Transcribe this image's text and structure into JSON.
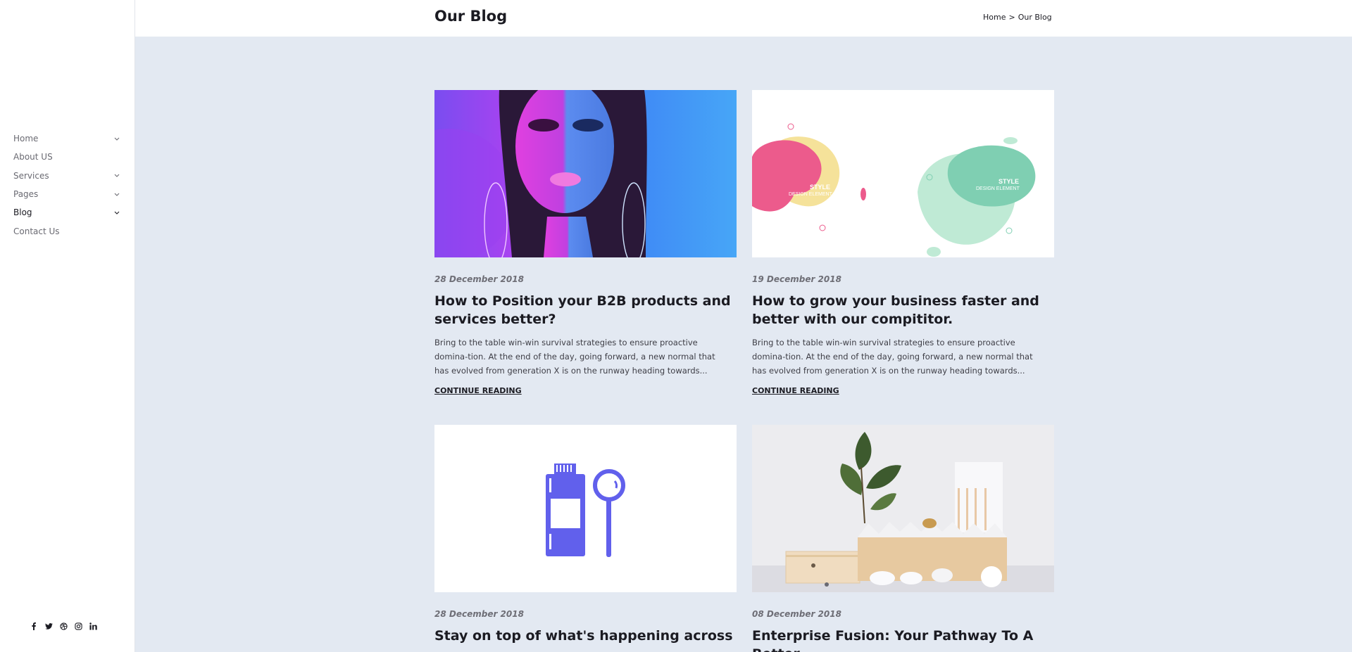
{
  "sidebar": {
    "nav": [
      {
        "label": "Home",
        "has_children": true
      },
      {
        "label": "About US",
        "has_children": false
      },
      {
        "label": "Services",
        "has_children": true
      },
      {
        "label": "Pages",
        "has_children": true
      },
      {
        "label": "Blog",
        "has_children": true,
        "active": true
      },
      {
        "label": "Contact Us",
        "has_children": false
      }
    ],
    "socials": [
      "facebook-icon",
      "twitter-icon",
      "dribbble-icon",
      "instagram-icon",
      "linkedin-icon"
    ]
  },
  "header": {
    "title": "Our Blog",
    "breadcrumb": {
      "home": "Home",
      "separator": ">",
      "current": "Our Blog"
    }
  },
  "posts": [
    {
      "date": "28 December 2018",
      "title": "How to Position your B2B products and services better?",
      "excerpt": "Bring to the table win-win survival strategies to ensure proactive domina-tion. At the end of the day, going forward, a new normal that has evolved from generation X is on the runway heading towards...",
      "more": "CONTINUE READING"
    },
    {
      "date": "19 December 2018",
      "title": "How to grow your business faster and better with our compititor.",
      "excerpt": "Bring to the table win-win survival strategies to ensure proactive domina-tion. At the end of the day, going forward, a new normal that has evolved from generation X is on the runway heading towards...",
      "more": "CONTINUE READING",
      "image_text": [
        "STYLE",
        "DESIGN ELEMENT",
        "STYLE",
        "DESIGN ELEMENT"
      ]
    },
    {
      "date": "28 December 2018",
      "title": "Stay on top of what's happening across",
      "excerpt": "",
      "more": ""
    },
    {
      "date": "08 December 2018",
      "title": "Enterprise Fusion: Your Pathway To A Better",
      "excerpt": "",
      "more": ""
    }
  ],
  "colors": {
    "background": "#e3e9f2",
    "accent": "#5b5be8",
    "text": "#1b1b22"
  }
}
